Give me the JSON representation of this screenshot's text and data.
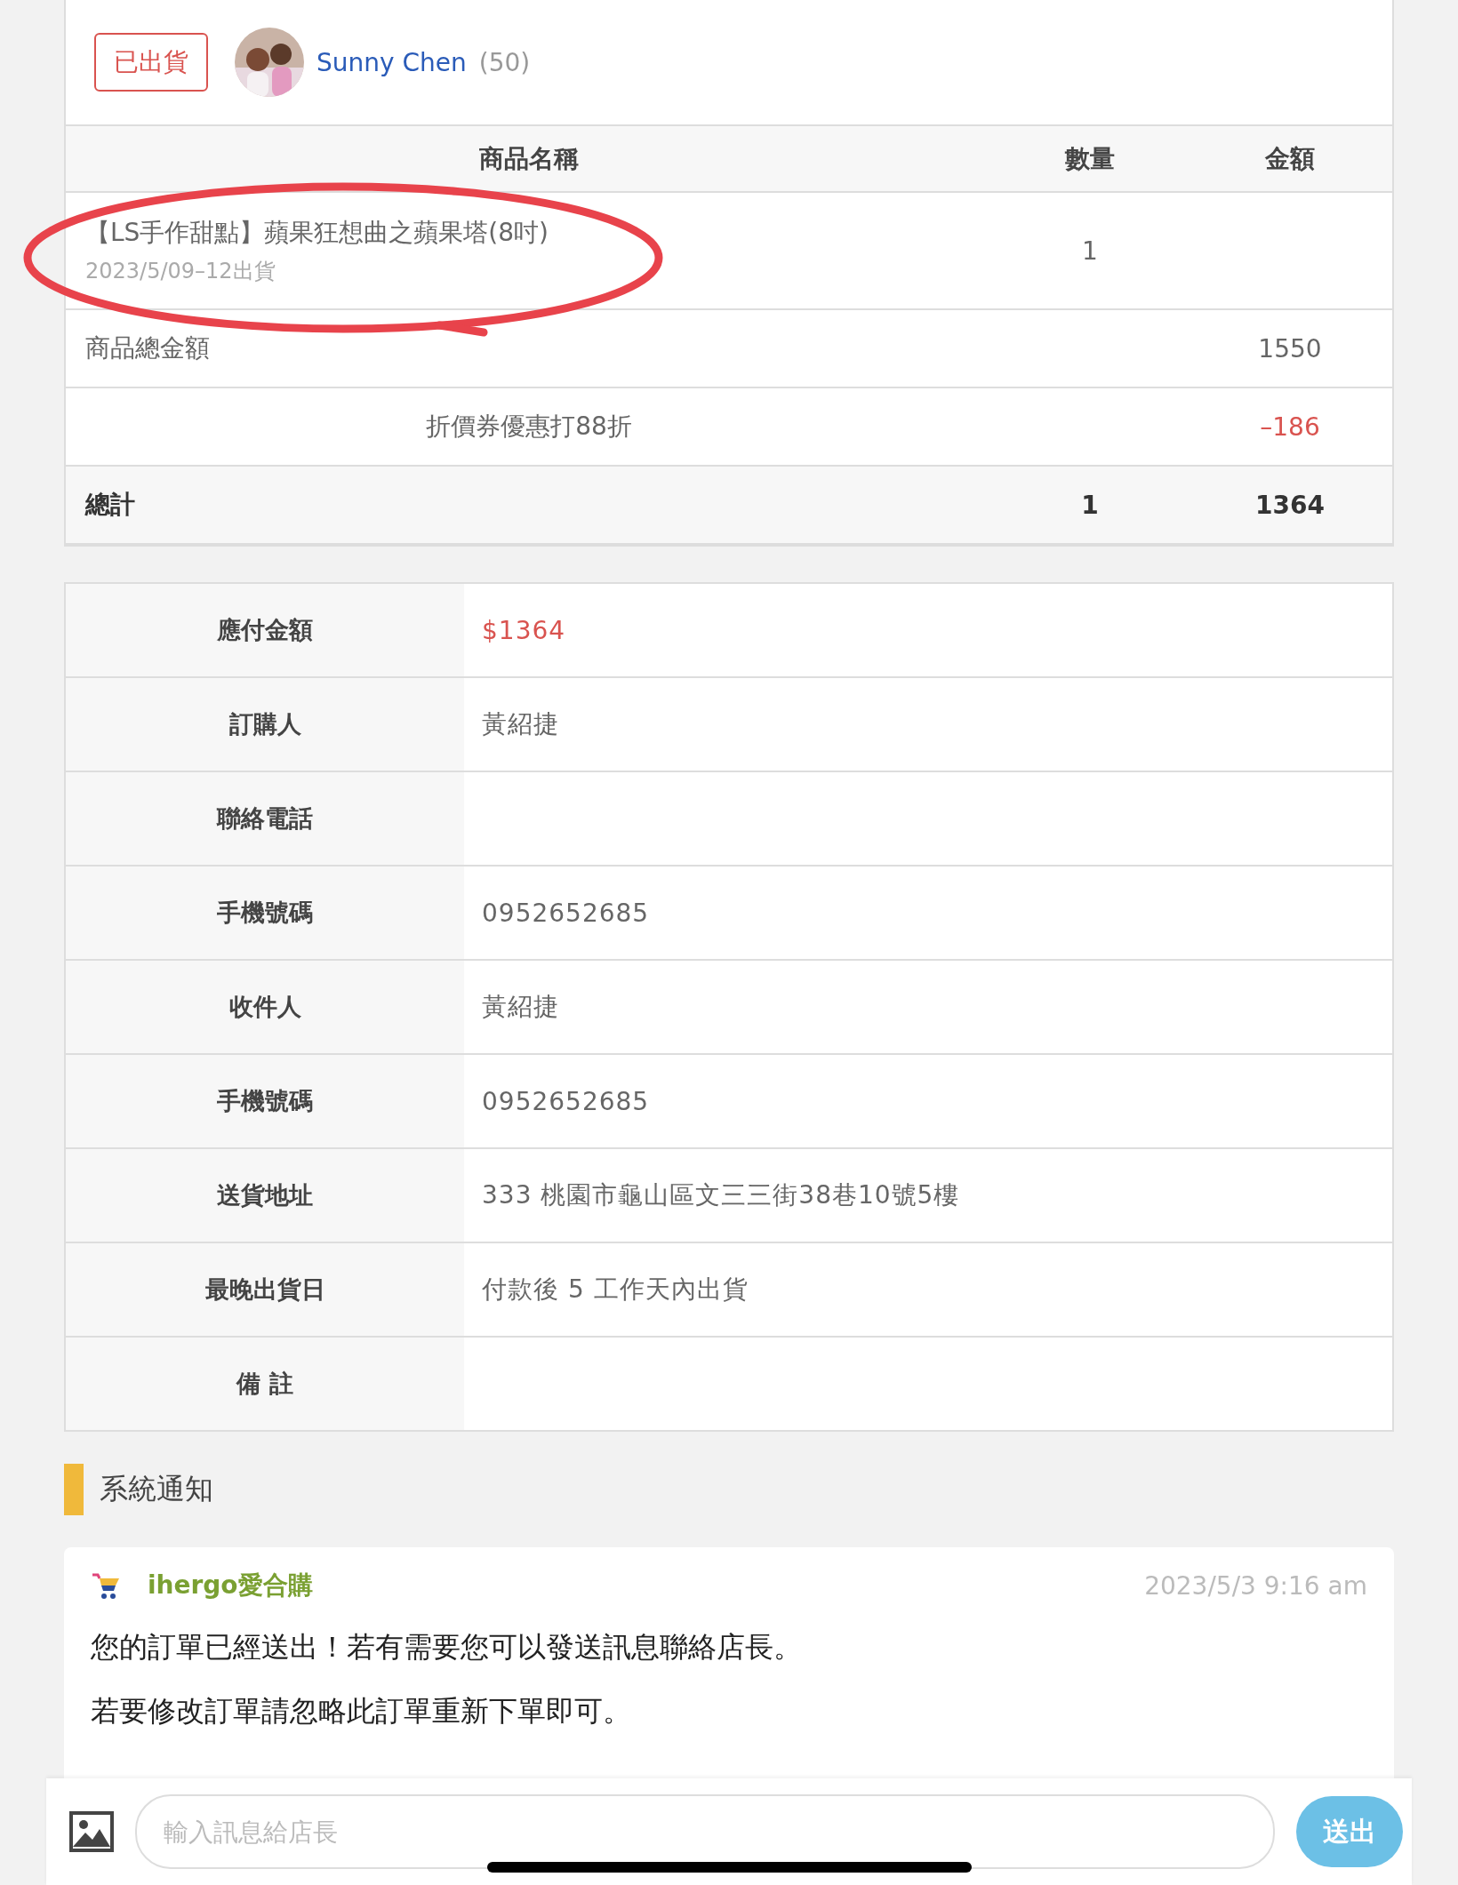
{
  "order_header": {
    "status": "已出貨",
    "buyer": {
      "name": "Sunny Chen",
      "score": "(50)"
    }
  },
  "items_table": {
    "columns": [
      "商品名稱",
      "數量",
      "金額"
    ],
    "items": [
      {
        "name": "【LS手作甜點】蘋果狂想曲之蘋果塔(8吋)",
        "note": "2023/5/09–12出貨",
        "quantity": "1"
      }
    ],
    "subtotal": {
      "label": "商品總金額",
      "amount": "1550"
    },
    "discount": {
      "label": "折價券優惠打88折",
      "amount": "–186"
    },
    "total": {
      "label": "總計",
      "quantity": "1",
      "amount": "1364"
    }
  },
  "info_table": [
    {
      "label": "應付金額",
      "value": "$1364",
      "kind": "price"
    },
    {
      "label": "訂購人",
      "value": "黃紹捷",
      "kind": "text"
    },
    {
      "label": "聯絡電話",
      "kind": "text"
    },
    {
      "label": "手機號碼",
      "value": "0952652685",
      "kind": "text"
    },
    {
      "label": "收件人",
      "value": "黃紹捷",
      "kind": "text"
    },
    {
      "label": "手機號碼",
      "value": "0952652685",
      "kind": "text"
    },
    {
      "label": "送貨地址",
      "value": "333 桃園市龜山區文三三街38巷10號5樓",
      "kind": "text"
    },
    {
      "label": "最晚出貨日",
      "value": "付款後 5 工作天內出貨",
      "kind": "text"
    },
    {
      "label": "備 註",
      "kind": "text"
    }
  ],
  "notifications": {
    "title": "系統通知",
    "messages": [
      {
        "sender": "ihergo愛合購",
        "time": "2023/5/3  9:16 am",
        "paragraphs": [
          "您的訂單已經送出！若有需要您可以發送訊息聯絡店長。",
          "若要修改訂單請忽略此訂單重新下單即可。"
        ]
      }
    ]
  },
  "composer": {
    "placeholder": "輸入訊息給店長",
    "send": "送出"
  }
}
